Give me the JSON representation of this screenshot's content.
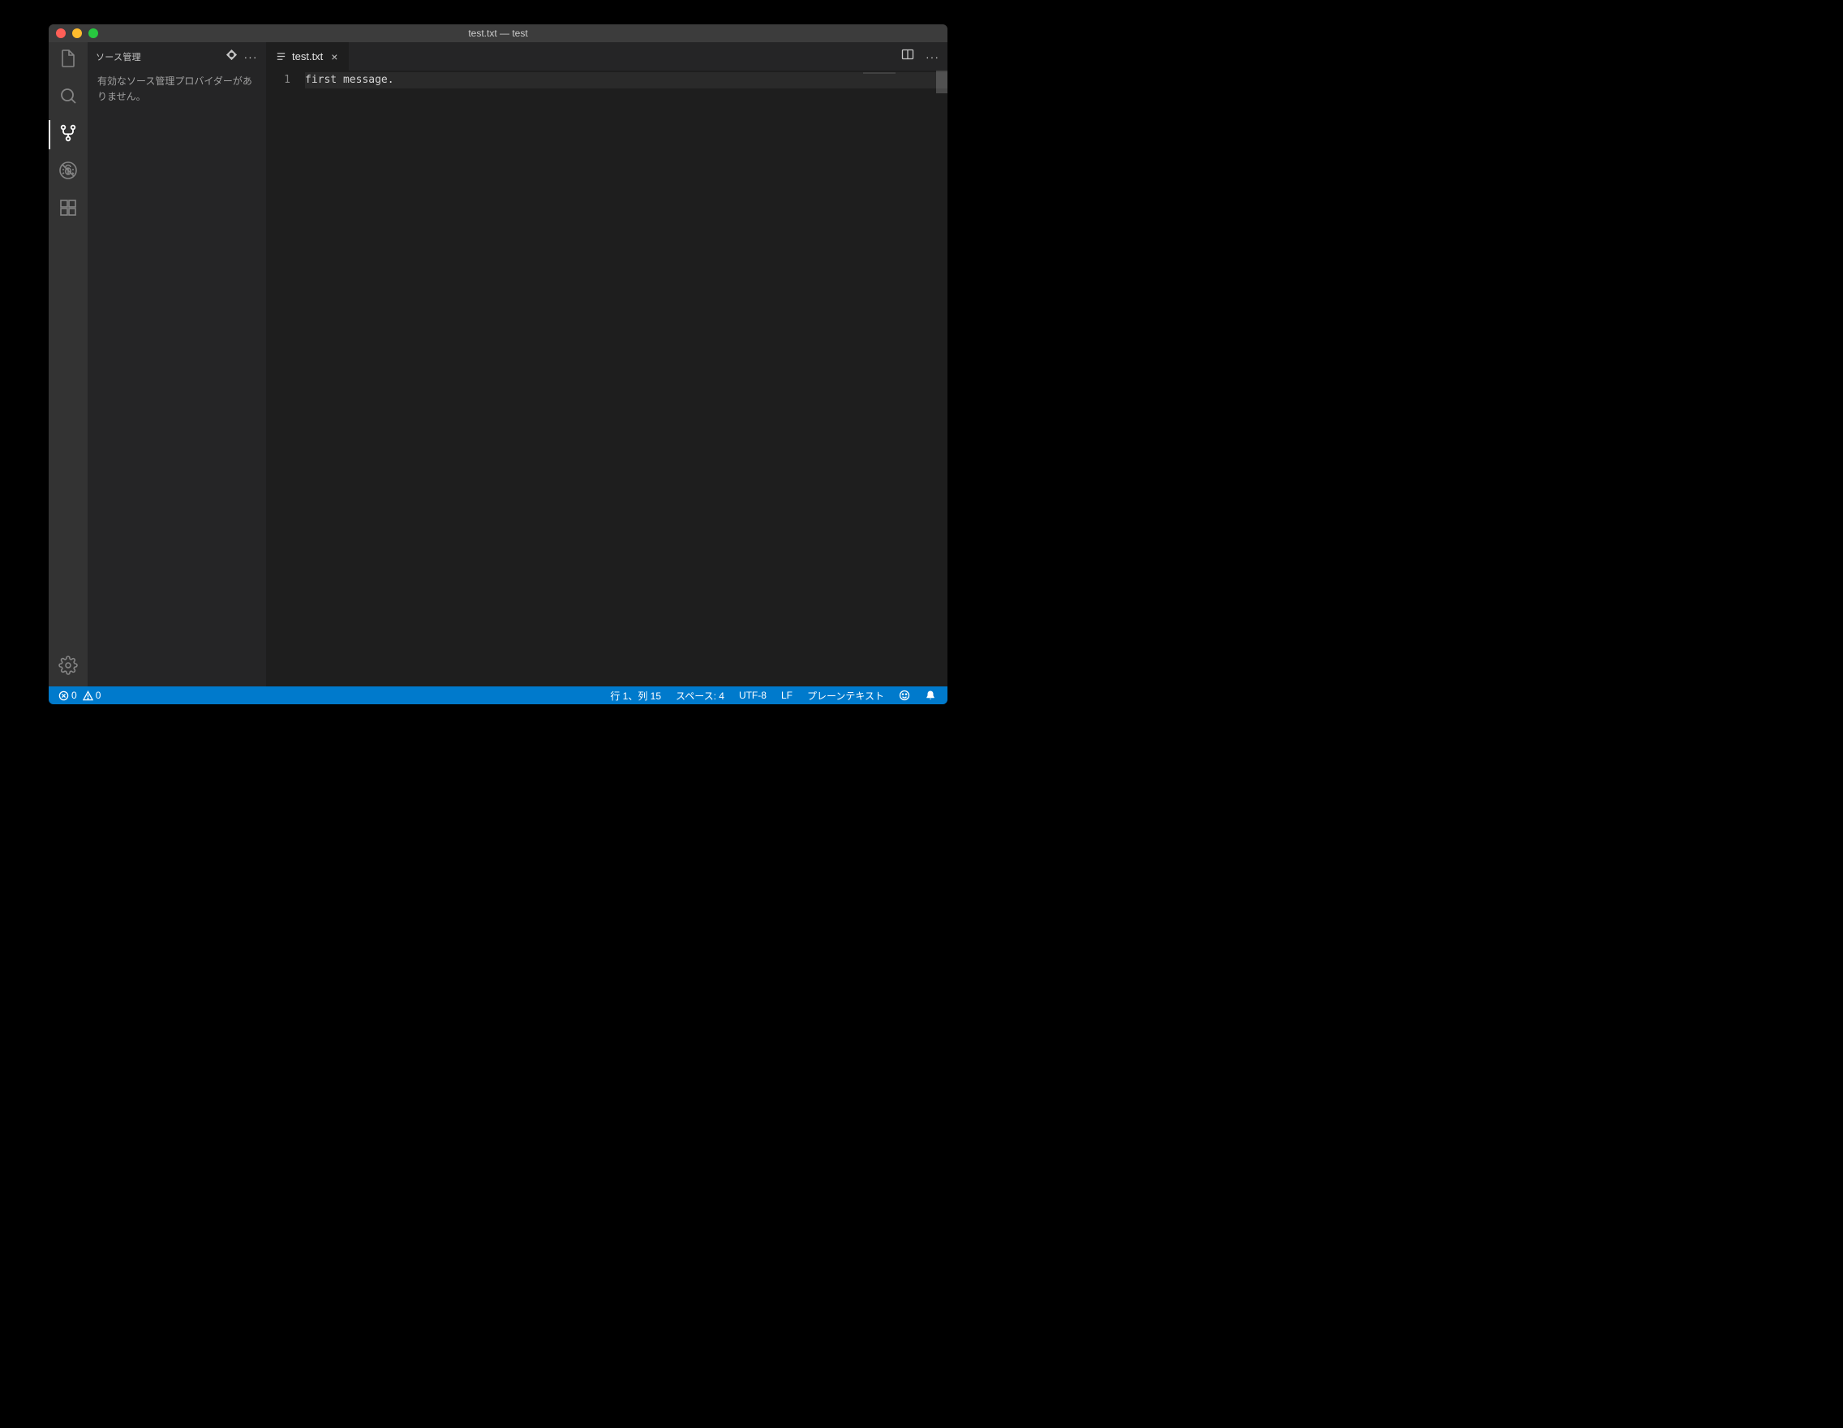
{
  "window": {
    "title": "test.txt — test"
  },
  "sidepanel": {
    "title": "ソース管理",
    "message": "有効なソース管理プロバイダーがありません。"
  },
  "tab": {
    "filename": "test.txt"
  },
  "editor": {
    "gutter1": "1",
    "line1": "first message."
  },
  "status": {
    "err_icon_count": "0",
    "warn_icon_count": "0",
    "cursor": "行 1、列 15",
    "spaces": "スペース: 4",
    "encoding": "UTF-8",
    "eol": "LF",
    "language": "プレーンテキスト"
  }
}
